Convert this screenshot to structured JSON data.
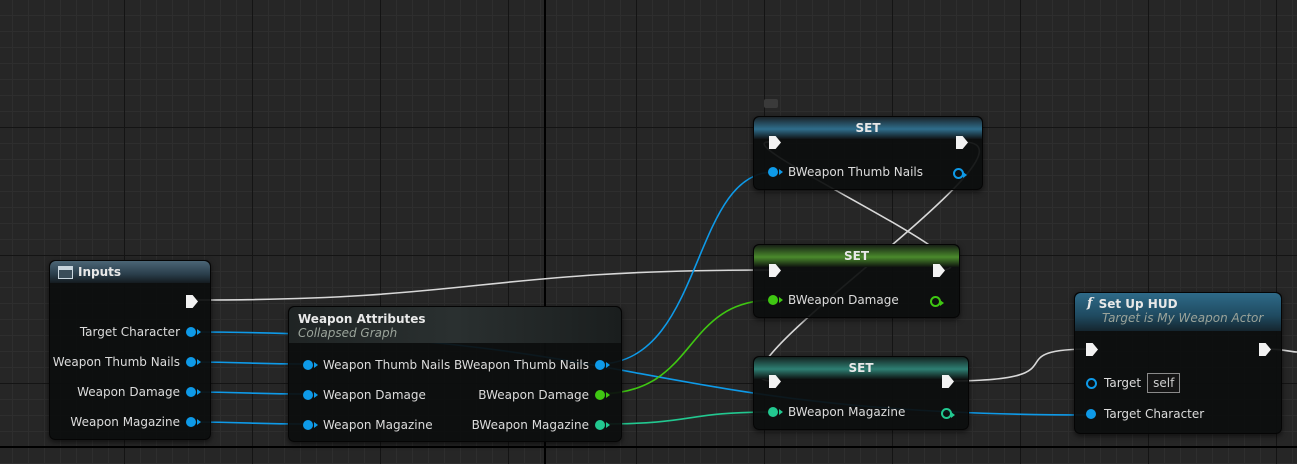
{
  "colors": {
    "background": "#262626",
    "exec_wire": "#d8d8d8",
    "object_pin": "#0e9ae8",
    "float_pin": "#3fc712",
    "int_pin": "#22c890"
  },
  "inputs_node": {
    "title": "Inputs",
    "icon": "panel-icon",
    "pins": [
      "Target Character",
      "Weapon Thumb Nails",
      "Weapon Damage",
      "Weapon Magazine"
    ]
  },
  "collapsed_node": {
    "title": "Weapon Attributes",
    "subtitle": "Collapsed Graph",
    "inputs": [
      "Weapon Thumb Nails",
      "Weapon Damage",
      "Weapon Magazine"
    ],
    "outputs": [
      "BWeapon Thumb Nails",
      "BWeapon Damage",
      "BWeapon Magazine"
    ]
  },
  "set_nodes": [
    {
      "title": "SET",
      "pin": "BWeapon Thumb Nails"
    },
    {
      "title": "SET",
      "pin": "BWeapon Damage"
    },
    {
      "title": "SET",
      "pin": "BWeapon Magazine"
    }
  ],
  "hud_node": {
    "icon": "function-icon",
    "title": "Set Up HUD",
    "subtitle": "Target is My Weapon Actor",
    "target_label": "Target",
    "target_value": "self",
    "target_character_label": "Target Character"
  }
}
